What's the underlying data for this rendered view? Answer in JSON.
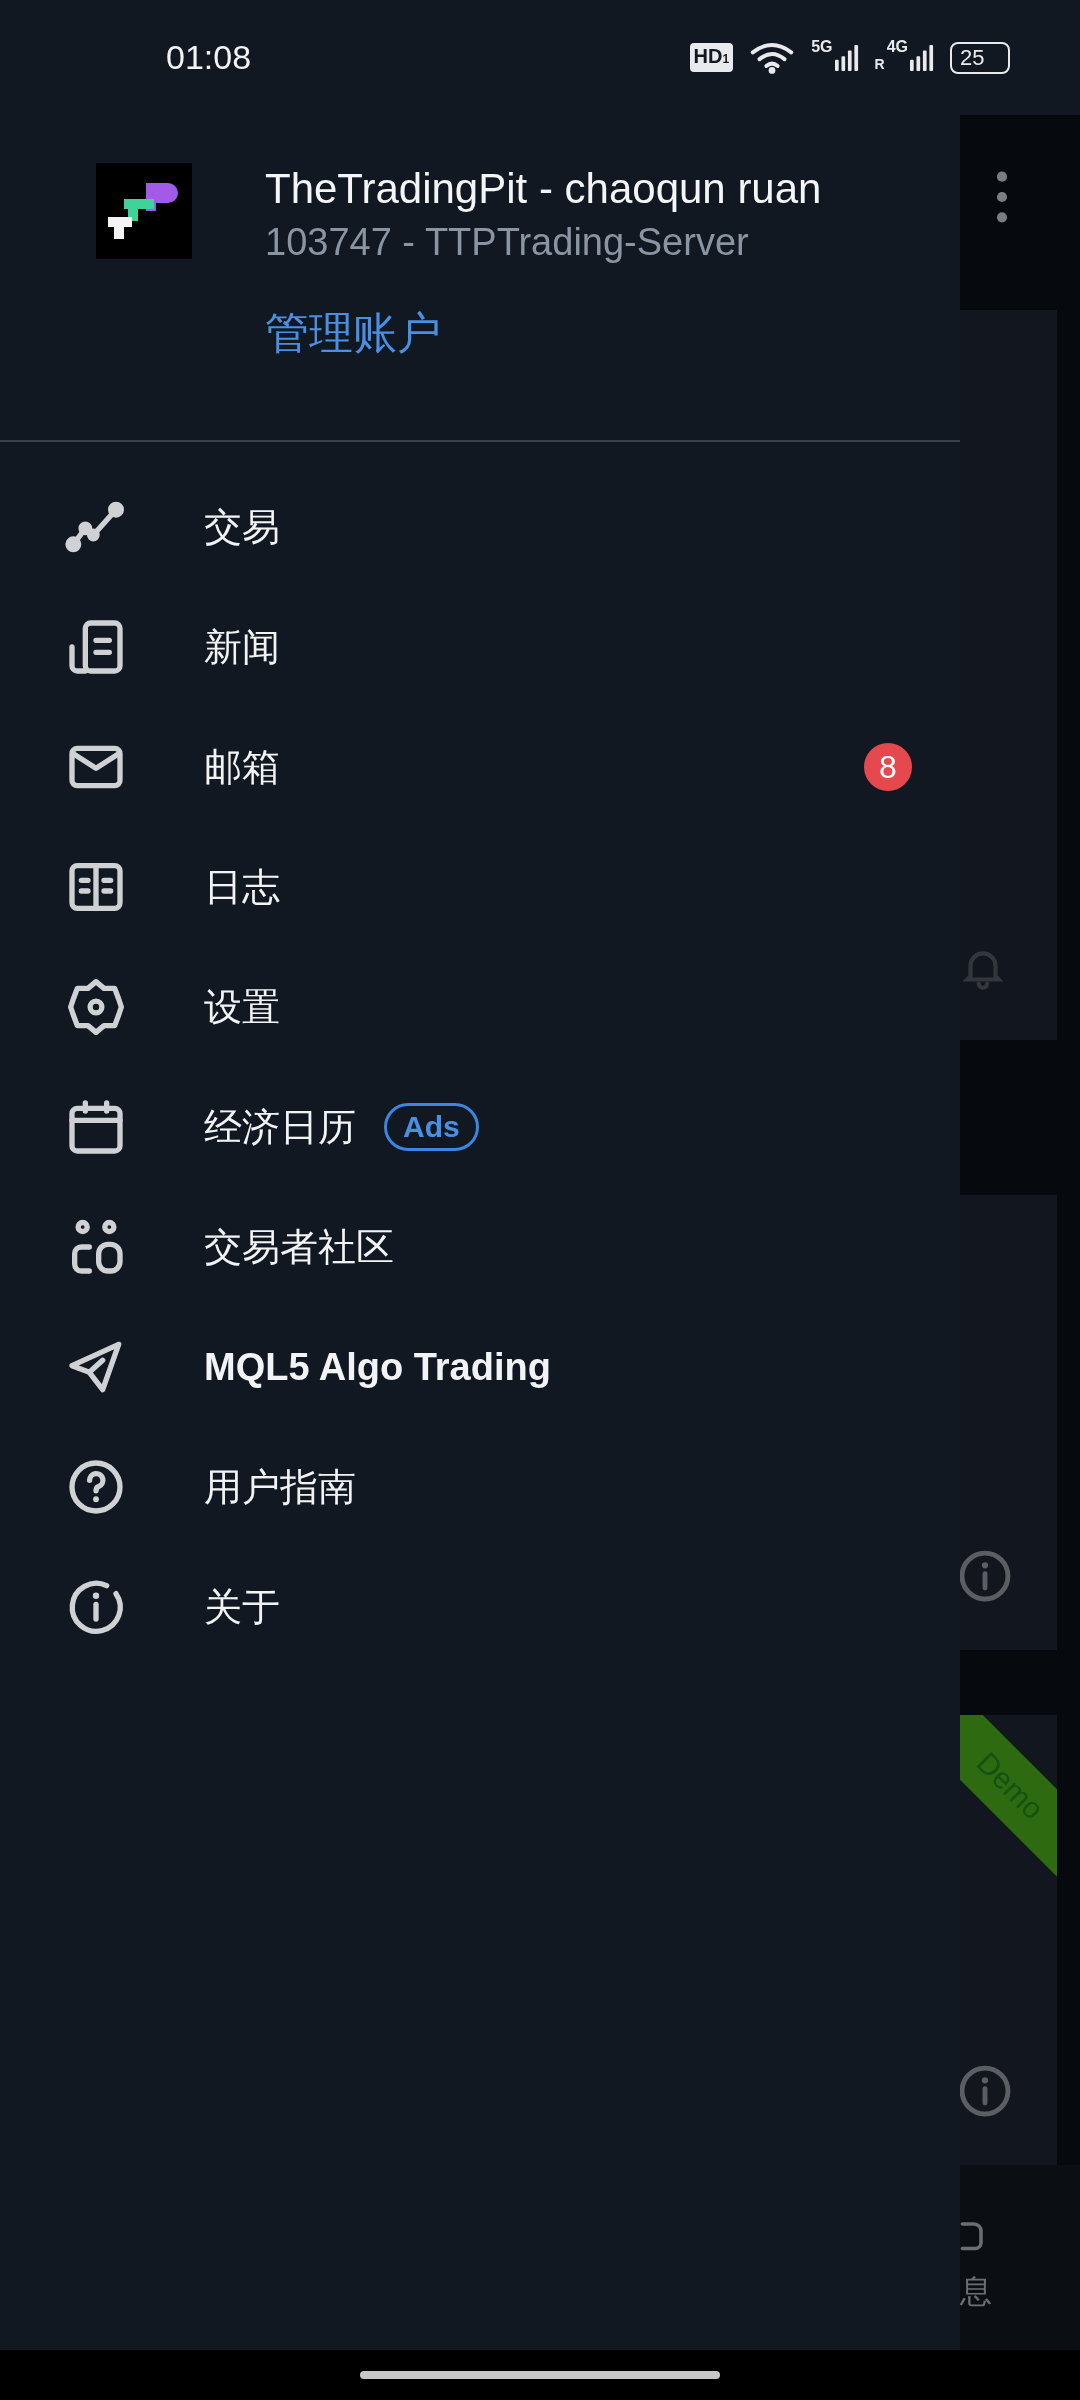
{
  "status_bar": {
    "time": "01:08",
    "hd_label": "HD",
    "hd_index": "1",
    "signal_1_label": "5G",
    "roaming_label": "R",
    "signal_2_label": "4G",
    "battery": "25"
  },
  "account": {
    "broker_user": "TheTradingPit - chaoqun ruan",
    "login_server": "103747 - TTPTrading-Server",
    "manage_link": "管理账户"
  },
  "menu": [
    {
      "kind": "trade",
      "label": "交易",
      "bold": false
    },
    {
      "kind": "news",
      "label": "新闻",
      "bold": false
    },
    {
      "kind": "mail",
      "label": "邮箱",
      "bold": false,
      "badge": "8"
    },
    {
      "kind": "journal",
      "label": "日志",
      "bold": false
    },
    {
      "kind": "settings",
      "label": "设置",
      "bold": false
    },
    {
      "kind": "calendar",
      "label": "经济日历",
      "bold": false,
      "tag": "Ads"
    },
    {
      "kind": "community",
      "label": "交易者社区",
      "bold": false
    },
    {
      "kind": "send",
      "label": "MQL5 Algo Trading",
      "bold": true
    },
    {
      "kind": "help",
      "label": "用户指南",
      "bold": false
    },
    {
      "kind": "about",
      "label": "关于",
      "bold": false
    }
  ],
  "background_app": {
    "demo_ribbon": "Demo",
    "nav_label": "息"
  }
}
